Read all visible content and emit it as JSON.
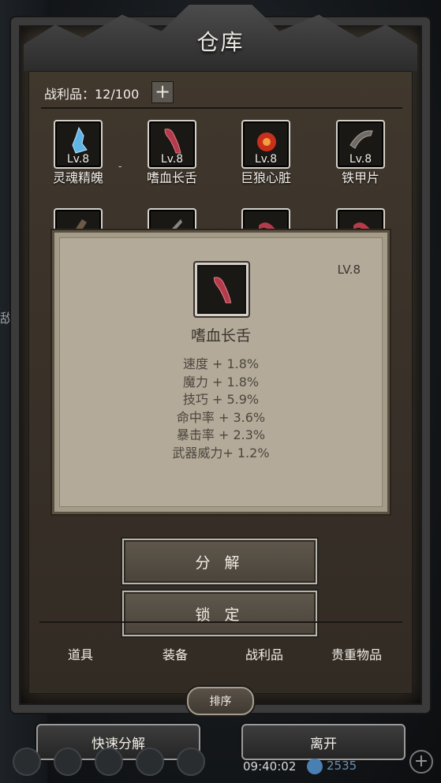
{
  "window": {
    "title": "仓库"
  },
  "loot": {
    "count_label": "战利品：12/100",
    "add_symbol": "+"
  },
  "items": [
    {
      "level": "Lv.8",
      "name": "灵魂精魄",
      "icon": "soul-crystal-icon",
      "color": "#6ab8e8"
    },
    {
      "level": "Lv.8",
      "name": "嗜血长舌",
      "icon": "blood-tongue-icon",
      "color": "#b43c4c"
    },
    {
      "level": "Lv.8",
      "name": "巨狼心脏",
      "icon": "wolf-heart-icon",
      "color": "#d8442c"
    },
    {
      "level": "Lv.8",
      "name": "铁甲片",
      "icon": "iron-plate-icon",
      "color": "#7a7570"
    }
  ],
  "row2_icons": [
    "claw-icon",
    "blade-icon",
    "tongue-icon",
    "tongue-icon"
  ],
  "detail": {
    "level": "LV.8",
    "name": "嗜血长舌",
    "stats": [
      "速度 + 1.8%",
      "魔力 + 1.8%",
      "技巧 + 5.9%",
      "命中率 + 3.6%",
      "暴击率 + 2.3%",
      "武器威力+ 1.2%"
    ]
  },
  "actions": {
    "decompose": "分 解",
    "lock": "锁 定"
  },
  "tabs": [
    "道具",
    "装备",
    "战利品",
    "贵重物品"
  ],
  "sort_label": "排序",
  "bottom": {
    "quick_decompose": "快速分解",
    "leave": "离开"
  },
  "hud": {
    "time": "09:40:02",
    "gems": "2535"
  },
  "side": {
    "text": "敌会",
    "dash": "-"
  }
}
